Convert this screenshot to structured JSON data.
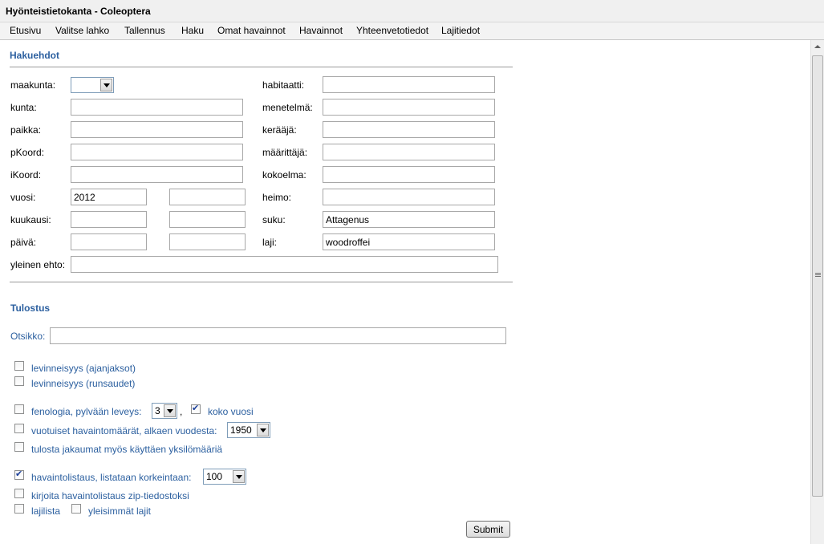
{
  "window": {
    "title": "Hyönteistietokanta - Coleoptera"
  },
  "menu": [
    "Etusivu",
    "Valitse lahko",
    "Tallennus",
    "Haku",
    "Omat havainnot",
    "Havainnot",
    "Yhteenvetotiedot",
    "Lajitiedot"
  ],
  "hakuehdot": {
    "heading": "Hakuehdot",
    "left": {
      "maakunta": {
        "label": "maakunta:",
        "value": ""
      },
      "kunta": {
        "label": "kunta:",
        "value": ""
      },
      "paikka": {
        "label": "paikka:",
        "value": ""
      },
      "pKoord": {
        "label": "pKoord:",
        "value": ""
      },
      "iKoord": {
        "label": "iKoord:",
        "value": ""
      },
      "vuosi": {
        "label": "vuosi:",
        "value_from": "2012",
        "value_to": ""
      },
      "kuukausi": {
        "label": "kuukausi:",
        "value_from": "",
        "value_to": ""
      },
      "paiva": {
        "label": "päivä:",
        "value_from": "",
        "value_to": ""
      }
    },
    "right": {
      "habitaatti": {
        "label": "habitaatti:",
        "value": ""
      },
      "menetelma": {
        "label": "menetelmä:",
        "value": ""
      },
      "keraaja": {
        "label": "kerääjä:",
        "value": ""
      },
      "maarittaja": {
        "label": "määrittäjä:",
        "value": ""
      },
      "kokoelma": {
        "label": "kokoelma:",
        "value": ""
      },
      "heimo": {
        "label": "heimo:",
        "value": ""
      },
      "suku": {
        "label": "suku:",
        "value": "Attagenus"
      },
      "laji": {
        "label": "laji:",
        "value": "woodroffei"
      }
    },
    "yleinen_ehto": {
      "label": "yleinen ehto:",
      "value": ""
    }
  },
  "tulostus": {
    "heading": "Tulostus",
    "otsikko": {
      "label": "Otsikko:",
      "value": ""
    },
    "levinneisyys_ajanjaksot": {
      "label": "levinneisyys (ajanjaksot)",
      "checked": false
    },
    "levinneisyys_runsaudet": {
      "label": "levinneisyys (runsaudet)",
      "checked": false
    },
    "fenologia": {
      "label": "fenologia,  pylvään leveys:",
      "checked": false,
      "width_value": "3",
      "comma": ",",
      "koko_vuosi_label": "koko vuosi",
      "koko_vuosi_checked": true
    },
    "vuotuiset": {
      "label": "vuotuiset havaintomäärät, alkaen vuodesta:",
      "checked": false,
      "year_value": "1950"
    },
    "yksilomaarat": {
      "label": "tulosta jakaumat myös käyttäen yksilömääriä",
      "checked": false
    },
    "havaintolistaus": {
      "label": "havaintolistaus, listataan korkeintaan:",
      "checked": true,
      "max_value": "100"
    },
    "zip": {
      "label": "kirjoita havaintolistaus zip-tiedostoksi",
      "checked": false
    },
    "lajilista": {
      "label": "lajilista",
      "checked": false
    },
    "yleisimmat": {
      "label": "yleisimmät lajit",
      "checked": false
    }
  },
  "submit_label": "Submit",
  "colors": {
    "heading": "#2b5f9f",
    "divider": "#9a9a9a"
  }
}
